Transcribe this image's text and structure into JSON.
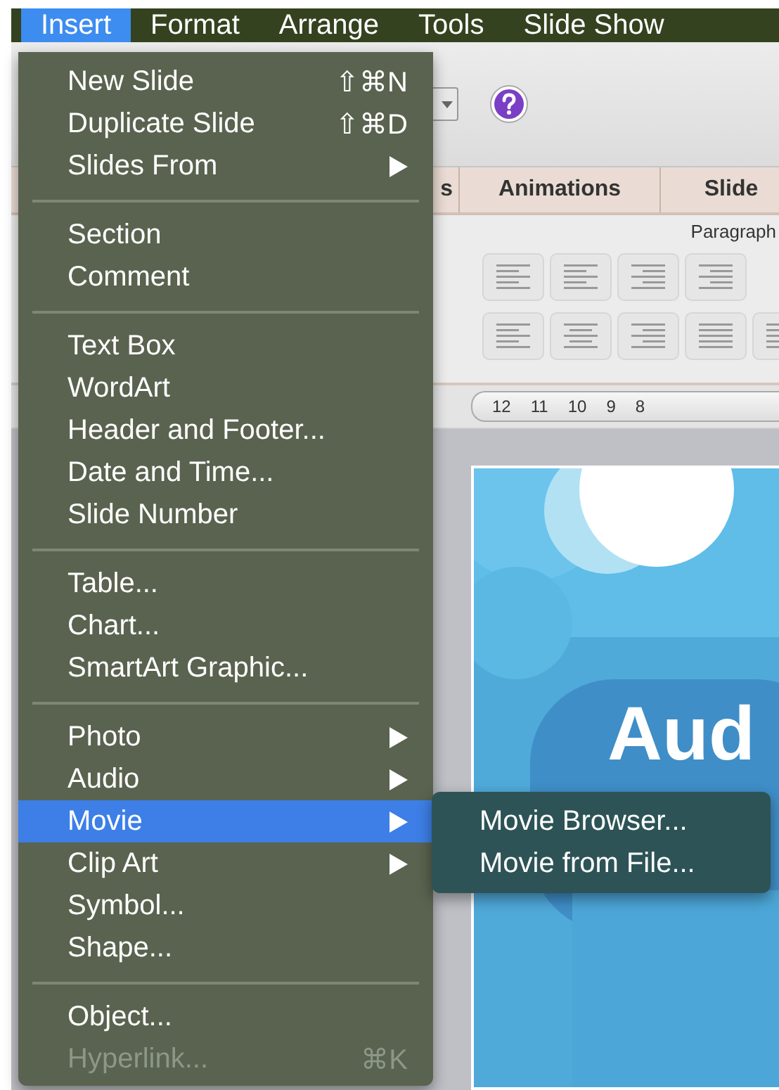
{
  "menubar": [
    {
      "label": "Insert",
      "selected": true
    },
    {
      "label": "Format",
      "selected": false
    },
    {
      "label": "Arrange",
      "selected": false
    },
    {
      "label": "Tools",
      "selected": false
    },
    {
      "label": "Slide Show",
      "selected": false
    }
  ],
  "tabs": [
    {
      "label": "s",
      "selected": false
    },
    {
      "label": "Animations",
      "selected": false
    },
    {
      "label": "Slide",
      "selected": false
    }
  ],
  "ribbon": {
    "group_label": "Paragraph"
  },
  "ruler": [
    "12",
    "11",
    "10",
    "9",
    "8"
  ],
  "slide": {
    "title": "Aud"
  },
  "menu": {
    "groups": [
      [
        {
          "label": "New Slide",
          "shortcut": "⇧⌘N",
          "has_submenu": false,
          "selected": false,
          "disabled": false
        },
        {
          "label": "Duplicate Slide",
          "shortcut": "⇧⌘D",
          "has_submenu": false,
          "selected": false,
          "disabled": false
        },
        {
          "label": "Slides From",
          "has_submenu": true,
          "selected": false,
          "disabled": false
        }
      ],
      [
        {
          "label": "Section",
          "has_submenu": false,
          "selected": false,
          "disabled": false
        },
        {
          "label": "Comment",
          "has_submenu": false,
          "selected": false,
          "disabled": false
        }
      ],
      [
        {
          "label": "Text Box",
          "has_submenu": false,
          "selected": false,
          "disabled": false
        },
        {
          "label": "WordArt",
          "has_submenu": false,
          "selected": false,
          "disabled": false
        },
        {
          "label": "Header and Footer...",
          "has_submenu": false,
          "selected": false,
          "disabled": false
        },
        {
          "label": "Date and Time...",
          "has_submenu": false,
          "selected": false,
          "disabled": false
        },
        {
          "label": "Slide Number",
          "has_submenu": false,
          "selected": false,
          "disabled": false
        }
      ],
      [
        {
          "label": "Table...",
          "has_submenu": false,
          "selected": false,
          "disabled": false
        },
        {
          "label": "Chart...",
          "has_submenu": false,
          "selected": false,
          "disabled": false
        },
        {
          "label": "SmartArt Graphic...",
          "has_submenu": false,
          "selected": false,
          "disabled": false
        }
      ],
      [
        {
          "label": "Photo",
          "has_submenu": true,
          "selected": false,
          "disabled": false
        },
        {
          "label": "Audio",
          "has_submenu": true,
          "selected": false,
          "disabled": false
        },
        {
          "label": "Movie",
          "has_submenu": true,
          "selected": true,
          "disabled": false
        },
        {
          "label": "Clip Art",
          "has_submenu": true,
          "selected": false,
          "disabled": false
        },
        {
          "label": "Symbol...",
          "has_submenu": false,
          "selected": false,
          "disabled": false
        },
        {
          "label": "Shape...",
          "has_submenu": false,
          "selected": false,
          "disabled": false
        }
      ],
      [
        {
          "label": "Object...",
          "has_submenu": false,
          "selected": false,
          "disabled": false
        },
        {
          "label": "Hyperlink...",
          "shortcut": "⌘K",
          "has_submenu": false,
          "selected": false,
          "disabled": true
        }
      ]
    ]
  },
  "submenu": [
    {
      "label": "Movie Browser..."
    },
    {
      "label": "Movie from File..."
    }
  ]
}
